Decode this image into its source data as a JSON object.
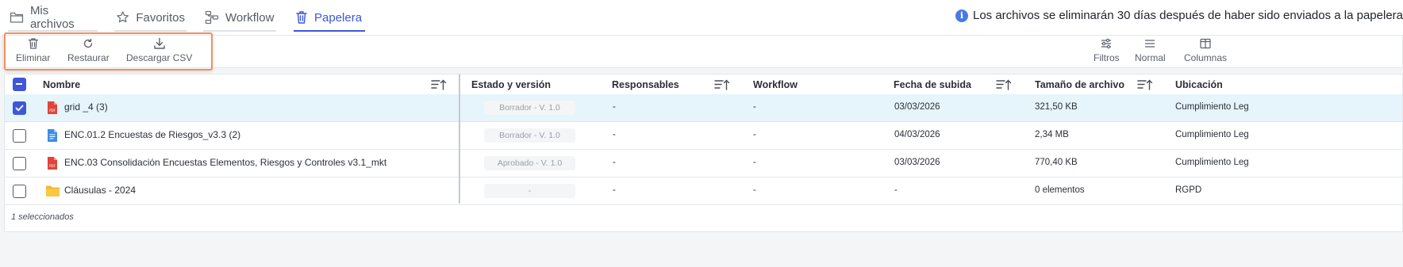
{
  "tabs": [
    {
      "label": "Mis archivos",
      "icon": "folder-icon",
      "active": false
    },
    {
      "label": "Favoritos",
      "icon": "star-icon",
      "active": false
    },
    {
      "label": "Workflow",
      "icon": "workflow-icon",
      "active": false
    },
    {
      "label": "Papelera",
      "icon": "trash-icon",
      "active": true
    }
  ],
  "notice": "Los archivos se eliminarán 30 días después de haber sido enviados a la papelera",
  "toolbar": {
    "delete_label": "Eliminar",
    "restore_label": "Restaurar",
    "download_label": "Descargar CSV",
    "filters_label": "Filtros",
    "view_label": "Normal",
    "columns_label": "Columnas"
  },
  "table": {
    "columns": [
      "Nombre",
      "Estado y versión",
      "Responsables",
      "Workflow",
      "Fecha de subida",
      "Tamaño de archivo",
      "Ubicación"
    ],
    "rows": [
      {
        "name": "grid _4 (3)",
        "type": "pdf",
        "status": "Borrador - V. 1.0",
        "responsables": "-",
        "workflow": "-",
        "date": "03/03/2026",
        "size": "321,50 KB",
        "location": "Cumplimiento Leg",
        "selected": true
      },
      {
        "name": "ENC.01.2 Encuestas de Riesgos_v3.3 (2)",
        "type": "doc",
        "status": "Borrador - V. 1.0",
        "responsables": "-",
        "workflow": "-",
        "date": "04/03/2026",
        "size": "2,34 MB",
        "location": "Cumplimiento Leg",
        "selected": false
      },
      {
        "name": "ENC.03 Consolidación Encuestas Elementos, Riesgos y Controles v3.1_mkt",
        "type": "pdf",
        "status": "Aprobado - V. 1.0",
        "responsables": "-",
        "workflow": "-",
        "date": "03/03/2026",
        "size": "770,40 KB",
        "location": "Cumplimiento Leg",
        "selected": false
      },
      {
        "name": "Cláusulas - 2024",
        "type": "folder",
        "status": "-",
        "responsables": "-",
        "workflow": "-",
        "date": "-",
        "size": "0 elementos",
        "location": "RGPD",
        "selected": false
      }
    ]
  },
  "footer": "1 seleccionados",
  "colors": {
    "accent": "#3d57d8",
    "highlight": "#f0915f",
    "selected_row": "#e6f4fb"
  }
}
